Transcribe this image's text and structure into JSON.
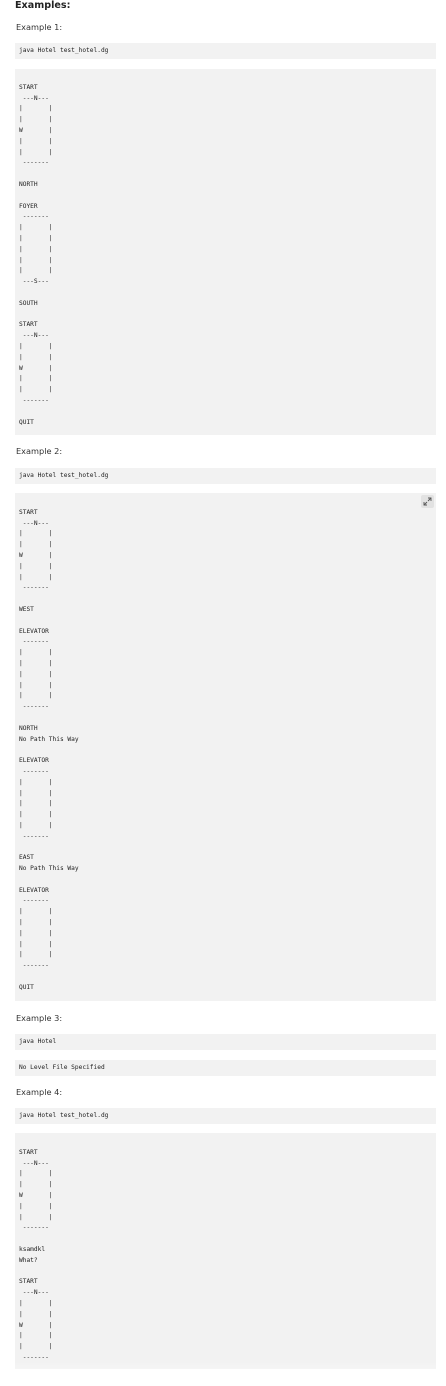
{
  "heading": "Examples:",
  "examples": [
    {
      "label": "Example 1:",
      "command": "java Hotel test_hotel.dg",
      "output": "\nSTART\n ---N---\n|       |\n|       |\nW       |\n|       |\n|       |\n -------\n\nNORTH\n\nFOYER\n -------\n|       |\n|       |\n|       |\n|       |\n|       |\n ---S---\n\nSOUTH\n\nSTART\n ---N---\n|       |\n|       |\nW       |\n|       |\n|       |\n -------\n\nQUIT"
    },
    {
      "label": "Example 2:",
      "command": "java Hotel test_hotel.dg",
      "output": "\nSTART\n ---N---\n|       |\n|       |\nW       |\n|       |\n|       |\n -------\n\nWEST\n\nELEVATOR\n -------\n|       |\n|       |\n|       |\n|       |\n|       |\n -------\n\nNORTH\nNo Path This Way\n\nELEVATOR\n -------\n|       |\n|       |\n|       |\n|       |\n|       |\n -------\n\nEAST\nNo Path This Way\n\nELEVATOR\n -------\n|       |\n|       |\n|       |\n|       |\n|       |\n -------\n\nQUIT"
    },
    {
      "label": "Example 3:",
      "command": "java Hotel",
      "output": "No Level File Specified"
    },
    {
      "label": "Example 4:",
      "command": "java Hotel test_hotel.dg",
      "output": "\nSTART\n ---N---\n|       |\n|       |\nW       |\n|       |\n|       |\n -------\n\nksamdkl\nWhat?\n\nSTART\n ---N---\n|       |\n|       |\nW       |\n|       |\n|       |\n -------"
    }
  ],
  "icons": {
    "expand": "expand-arrows-icon"
  },
  "colors": {
    "code_bg": "#f2f2f2",
    "text": "#222222",
    "button_bg": "#e2e2e2"
  }
}
